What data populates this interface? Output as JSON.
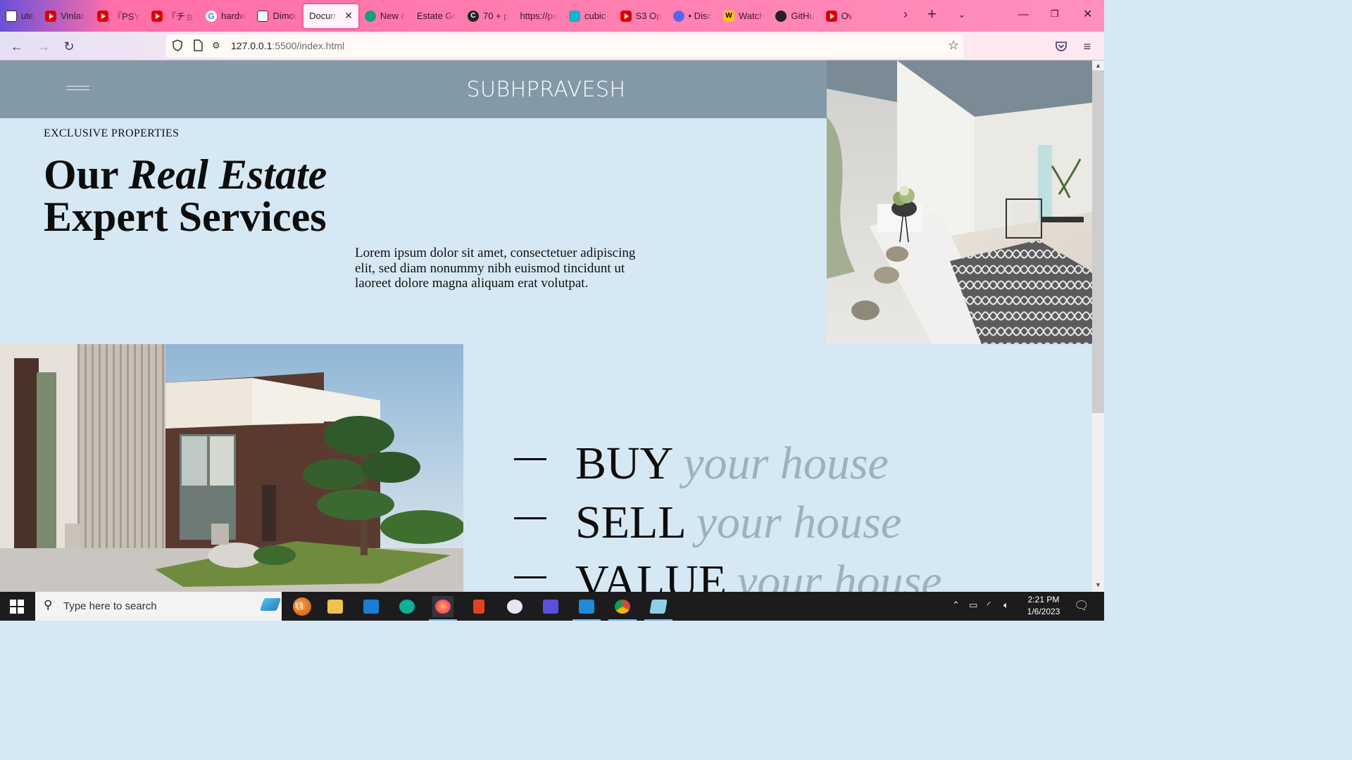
{
  "browser": {
    "tabs": [
      {
        "label": "ute",
        "icon": "page-icon",
        "active": false
      },
      {
        "label": "Vinlan",
        "icon": "youtube-icon",
        "active": false
      },
      {
        "label": "『PSY",
        "icon": "youtube-icon",
        "active": false
      },
      {
        "label": "『チョ",
        "icon": "youtube-icon",
        "active": false
      },
      {
        "label": "hardw",
        "icon": "google-icon",
        "active": false
      },
      {
        "label": "Dimor",
        "icon": "document-icon",
        "active": false
      },
      {
        "label": "Docum",
        "icon": "none",
        "active": true
      },
      {
        "label": "New c",
        "icon": "chatgpt-icon",
        "active": false
      },
      {
        "label": "Estate Gro",
        "icon": "none",
        "active": false
      },
      {
        "label": "70 + p",
        "icon": "c-icon",
        "active": false
      },
      {
        "label": "https://pe",
        "icon": "none",
        "active": false
      },
      {
        "label": "cubic-",
        "icon": "cubic-icon",
        "active": false
      },
      {
        "label": "S3 Op",
        "icon": "youtube-icon",
        "active": false
      },
      {
        "label": "• Disc",
        "icon": "discord-icon",
        "active": false
      },
      {
        "label": "Watch",
        "icon": "w-icon",
        "active": false
      },
      {
        "label": "GitHu",
        "icon": "github-icon",
        "active": false
      },
      {
        "label": "Ov",
        "icon": "youtube-icon",
        "active": false
      }
    ],
    "url_host": "127.0.0.1",
    "url_rest": ":5500/index.html"
  },
  "site": {
    "brand": "SUBHPRAVESH",
    "eyebrow": "EXCLUSIVE PROPERTIES",
    "title_line1_plain": "Our ",
    "title_line1_italic": "Real Estate",
    "title_line2": "Expert Services",
    "lorem": "Lorem ipsum dolor sit amet, consectetuer adipiscing elit, sed diam nonummy nibh euismod tincidunt ut laoreet dolore magna aliquam erat volutpat.",
    "services": [
      {
        "verb": "BUY",
        "tail": "your house"
      },
      {
        "verb": "SELL",
        "tail": "your house"
      },
      {
        "verb": "VALUE",
        "tail": "your house"
      }
    ]
  },
  "taskbar": {
    "search_placeholder": "Type here to search",
    "time": "2:21 PM",
    "date": "1/6/2023"
  },
  "colors": {
    "page_bg": "#d6e8f3",
    "header_bg": "#8499a8",
    "tail_text": "#9fb0bb"
  }
}
